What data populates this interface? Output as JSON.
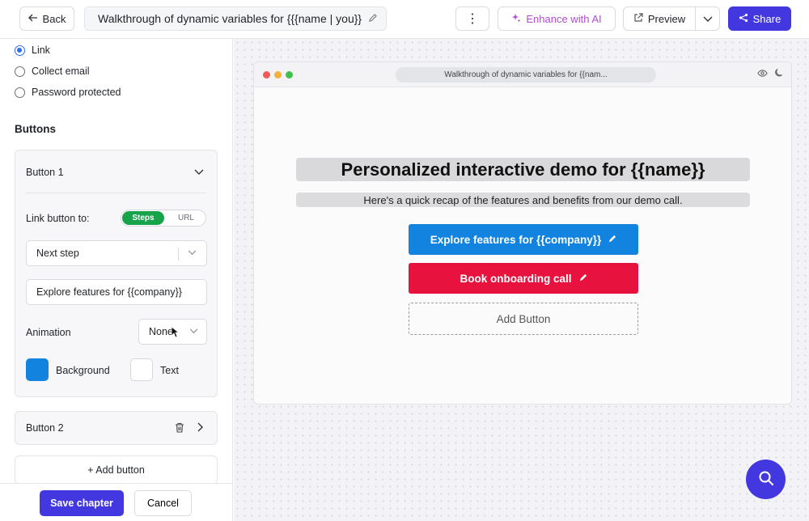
{
  "topbar": {
    "back_label": "Back",
    "title": "Walkthrough of dynamic variables for {{{name | you}}",
    "more_label": "⋮",
    "enhance_label": "Enhance with AI",
    "preview_label": "Preview",
    "share_label": "Share"
  },
  "access": {
    "options": [
      {
        "label": "Link",
        "checked": true
      },
      {
        "label": "Collect email",
        "checked": false
      },
      {
        "label": "Password protected",
        "checked": false
      }
    ]
  },
  "buttons_section": {
    "title": "Buttons",
    "button1": {
      "title": "Button 1",
      "link_label": "Link button to:",
      "toggle_on": "Steps",
      "toggle_off": "URL",
      "link_target": "Next step",
      "button_text": "Explore features for {{company}}",
      "animation_label": "Animation",
      "animation_value": "None",
      "background_label": "Background",
      "background_color": "#1283de",
      "text_label": "Text",
      "text_color": "#ffffff"
    },
    "button2": {
      "title": "Button 2"
    },
    "add_label": "+ Add button"
  },
  "footer": {
    "save_label": "Save chapter",
    "cancel_label": "Cancel"
  },
  "preview": {
    "url": "Walkthrough of dynamic variables for {{nam...",
    "heading": "Personalized interactive demo for {{name}}",
    "subheading": "Here's a quick recap of the features and benefits from our demo call.",
    "cta_primary": "Explore features for {{company}}",
    "cta_secondary": "Book onboarding call",
    "cta_add": "Add Button"
  },
  "colors": {
    "accent": "#4338e0",
    "primary_cta": "#1283de",
    "secondary_cta": "#e8123f",
    "toggle_on": "#16a34a"
  }
}
